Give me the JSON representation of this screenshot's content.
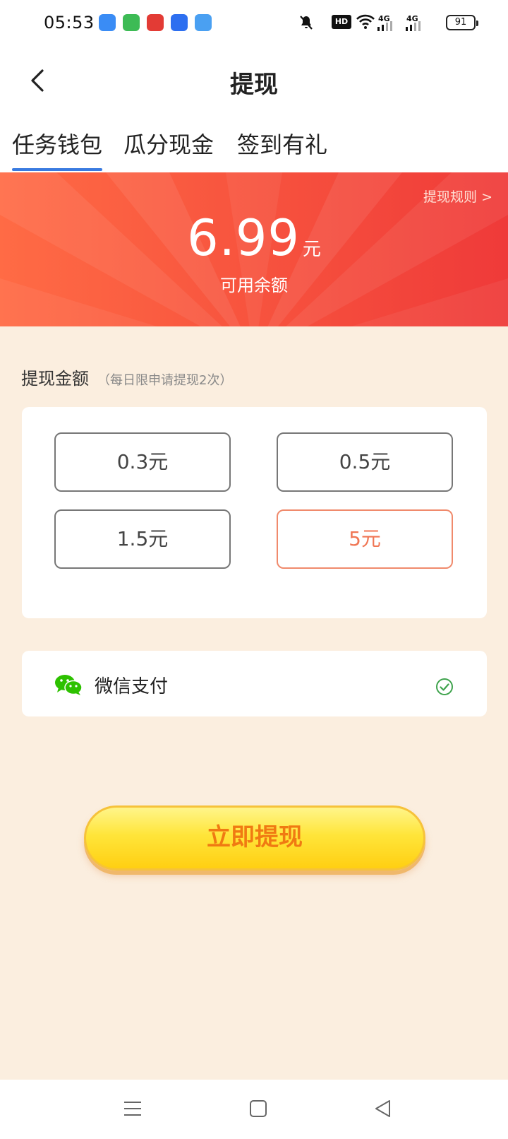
{
  "status_bar": {
    "time": "05:53",
    "hd_label": "HD",
    "signal1": "4G",
    "signal2": "4G",
    "battery": "91",
    "apps": [
      {
        "icon": "app-blue-icon",
        "color": "#3a8cf5"
      },
      {
        "icon": "app-green-icon",
        "color": "#3dbb55"
      },
      {
        "icon": "app-red-icon",
        "color": "#e33b35"
      },
      {
        "icon": "app-shield-icon",
        "color": "#2d6ff0"
      },
      {
        "icon": "app-lightblue-icon",
        "color": "#4aa0f2"
      }
    ]
  },
  "header": {
    "title": "提现"
  },
  "tabs": [
    {
      "label": "任务钱包",
      "active": true
    },
    {
      "label": "瓜分现金",
      "active": false
    },
    {
      "label": "签到有礼",
      "active": false
    }
  ],
  "banner": {
    "rules_link": "提现规则 >",
    "balance": "6.99",
    "unit": "元",
    "label": "可用余额"
  },
  "amount": {
    "title": "提现金额",
    "note": "（每日限申请提现2次）",
    "options": [
      {
        "label": "0.3元",
        "selected": false
      },
      {
        "label": "0.5元",
        "selected": false
      },
      {
        "label": "1.5元",
        "selected": false
      },
      {
        "label": "5元",
        "selected": true
      }
    ]
  },
  "payment": {
    "method": "微信支付",
    "icon": "wechat-icon",
    "checked": true
  },
  "withdraw_button": "立即提现",
  "colors": {
    "accent_tab": "#3a7be0",
    "banner": "#f7533e",
    "selected_option": "#f07654",
    "button_text": "#f07a12",
    "page_bg": "#fbeedf"
  }
}
